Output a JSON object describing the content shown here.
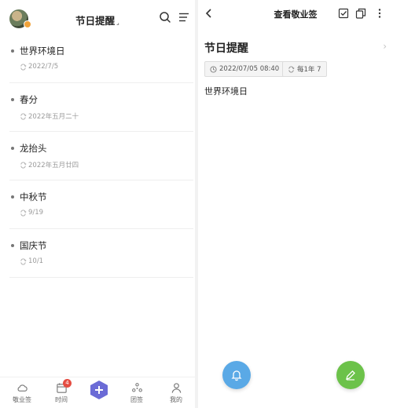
{
  "left": {
    "header": {
      "title": "节日提醒",
      "caret": "⌟"
    },
    "items": [
      {
        "title": "世界环境日",
        "sub": "2022/7/5"
      },
      {
        "title": "春分",
        "sub": "2022年五月二十"
      },
      {
        "title": "龙抬头",
        "sub": "2022年五月廿四"
      },
      {
        "title": "中秋节",
        "sub": "9/19"
      },
      {
        "title": "国庆节",
        "sub": "10/1"
      }
    ],
    "nav": {
      "items": [
        {
          "label": "敬业签"
        },
        {
          "label": "时间",
          "badge": "4"
        },
        {
          "label": "团签"
        },
        {
          "label": "我的"
        }
      ]
    }
  },
  "right": {
    "header": {
      "title": "查看敬业签"
    },
    "note_title": "节日提醒",
    "time_tag": "2022/07/05 08:40",
    "repeat_tag": "每1年 7",
    "content": "世界环境日"
  },
  "colors": {
    "accent_blue": "#5aa9e6",
    "accent_green": "#6cc24a",
    "add_purple": "#6b6bd6",
    "badge_red": "#e54d42"
  }
}
